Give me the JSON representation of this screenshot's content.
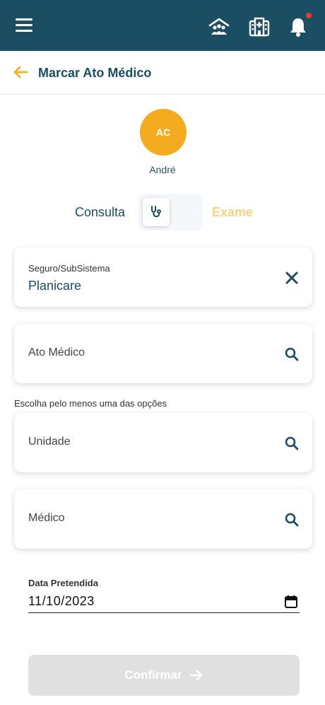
{
  "topbar": {
    "menu_icon": "hamburger-menu-icon",
    "icons": [
      "family-icon",
      "hospital-icon",
      "bell-icon"
    ],
    "notification_dot_color": "#e53935",
    "background_color": "#1b4d63"
  },
  "header": {
    "title": "Marcar Ato Médico",
    "back_icon": "arrow-left-icon",
    "accent_color": "#f5ab1f"
  },
  "patient": {
    "initials": "AC",
    "name": "André"
  },
  "type_toggle": {
    "option_left": "Consulta",
    "option_right": "Exame",
    "selected": "Consulta",
    "icon": "stethoscope-icon"
  },
  "insurance": {
    "label": "Seguro/SubSistema",
    "value": "Planicare"
  },
  "fields": {
    "ato_medico": "Ato Médico",
    "hint": "Escolha pelo menos uma das opções",
    "unidade": "Unidade",
    "medico": "Médico"
  },
  "date": {
    "label": "Data Pretendida",
    "value": "11/10/2023"
  },
  "confirm": {
    "label": "Confirmar"
  }
}
